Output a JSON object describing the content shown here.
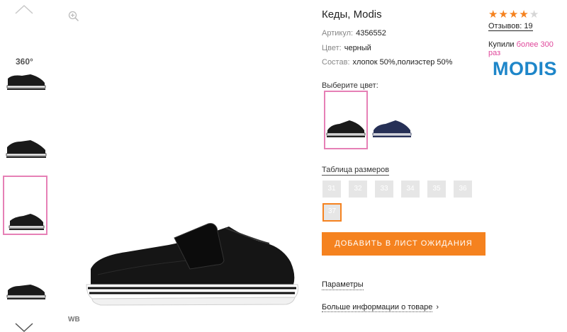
{
  "product": {
    "title": "Кеды, Modis",
    "article_label": "Артикул:",
    "article_value": "4356552",
    "color_label": "Цвет:",
    "color_value": "черный",
    "material_label": "Состав:",
    "material_value": "хлопок 50%,полиэстер 50%"
  },
  "color_choice": {
    "label": "Выберите цвет:",
    "swatches": [
      {
        "name": "black",
        "selected": true
      },
      {
        "name": "navy",
        "selected": false
      }
    ]
  },
  "sizes": {
    "table_link": "Таблица размеров",
    "items": [
      {
        "value": "31",
        "selected": false
      },
      {
        "value": "32",
        "selected": false
      },
      {
        "value": "33",
        "selected": false
      },
      {
        "value": "34",
        "selected": false
      },
      {
        "value": "35",
        "selected": false
      },
      {
        "value": "36",
        "selected": false
      },
      {
        "value": "37",
        "selected": true
      }
    ]
  },
  "actions": {
    "add_to_wishlist": "ДОБАВИТЬ В ЛИСТ ОЖИДАНИЯ",
    "params_link": "Параметры",
    "more_info_link": "Больше информации о товаре",
    "more_info_arrow": "›"
  },
  "rating": {
    "stars_filled": 4,
    "stars_total": 5,
    "reviews_text": "Отзывов: 19",
    "bought_prefix": "Купили",
    "bought_highlight": "более 300 раз"
  },
  "brand": {
    "logo_text": "MODIS"
  },
  "gallery": {
    "badge_360": "360°",
    "watermark": "WB",
    "selected_thumb": 3
  },
  "icons": [
    "chevron-up-icon",
    "chevron-down-icon",
    "zoom-in-icon",
    "star-icon"
  ],
  "colors": {
    "accent_orange": "#f5821f",
    "selection_pink": "#e680b6",
    "highlight_pink": "#e0479b",
    "brand_blue": "#1e86c9",
    "size_bg": "#e6e6e6"
  }
}
